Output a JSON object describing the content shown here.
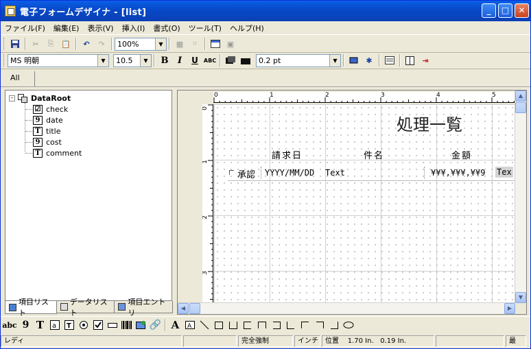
{
  "window": {
    "title": "電子フォームデザイナ - [list]"
  },
  "menu": [
    "ファイル(F)",
    "編集(E)",
    "表示(V)",
    "挿入(I)",
    "書式(O)",
    "ツール(T)",
    "ヘルプ(H)"
  ],
  "toolbar1": {
    "zoom": "100%"
  },
  "toolbar2": {
    "font": "MS 明朝",
    "size": "10.5",
    "bold": "B",
    "italic": "I",
    "underline": "U",
    "abc": "ABC",
    "line_width": "0.2 pt"
  },
  "tabs": {
    "all": "All"
  },
  "tree": {
    "root": "DataRoot",
    "items": [
      {
        "label": "check",
        "icon": "☑"
      },
      {
        "label": "date",
        "icon": "9"
      },
      {
        "label": "title",
        "icon": "T"
      },
      {
        "label": "cost",
        "icon": "9"
      },
      {
        "label": "comment",
        "icon": "T"
      }
    ]
  },
  "left_tabs": [
    "項目リスト",
    "データリスト",
    "項目エントリ"
  ],
  "ruler": {
    "h": [
      "0",
      "1",
      "2",
      "3",
      "4",
      "5"
    ],
    "v": [
      "0",
      "1",
      "2",
      "3"
    ]
  },
  "form": {
    "heading": "処理一覧",
    "col_date": "請求日",
    "col_name": "件名",
    "col_amount": "金額",
    "row_check": "承認",
    "row_date": "YYYY/MM/DD",
    "row_text": "Text",
    "row_amount": "¥¥¥,¥¥¥,¥¥9",
    "row_text2": "Tex"
  },
  "drawtools": [
    "abc",
    "9",
    "T"
  ],
  "status": {
    "ready": "レディ",
    "mode": "完全強制",
    "unit": "インチ",
    "pos_label": "位置",
    "pos_x": "1.70 In.",
    "pos_y": "0.19 In.",
    "last": "最"
  }
}
